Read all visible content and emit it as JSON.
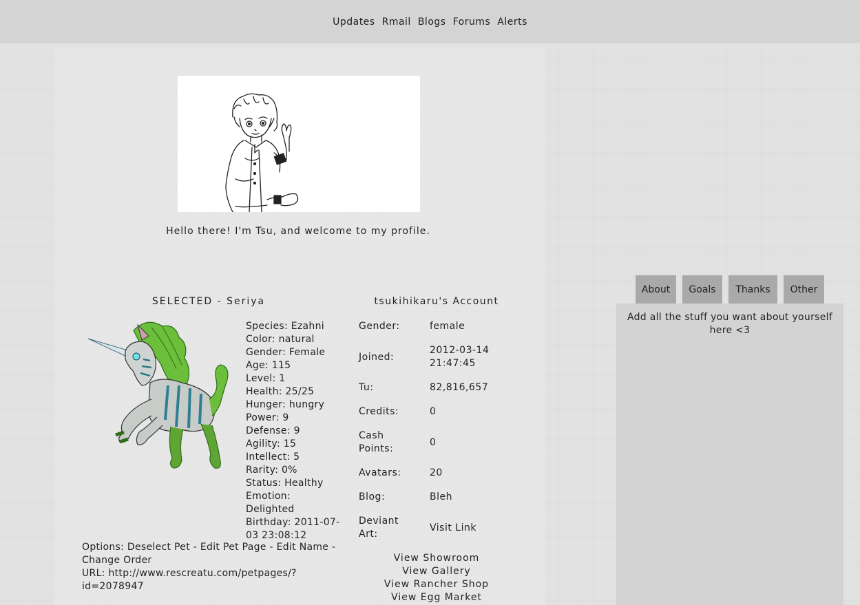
{
  "nav": {
    "items": [
      "Updates",
      "Rmail",
      "Blogs",
      "Forums",
      "Alerts"
    ]
  },
  "profile": {
    "welcome": "Hello there! I'm Tsu, and welcome to my profile."
  },
  "pet": {
    "title": "SELECTED - Seriya",
    "stats": [
      "Species: Ezahni",
      "Color: natural",
      "Gender: Female",
      "Age: 115",
      "Level: 1",
      "Health: 25/25",
      "Hunger: hungry",
      "Power: 9",
      "Defense: 9",
      "Agility: 15",
      "Intellect: 5",
      "Rarity: 0%",
      "Status: Healthy",
      "Emotion: Delighted",
      "Birthday: 2011-07-03 23:08:12"
    ],
    "options_label": "Options:",
    "options": [
      "Deselect Pet",
      "Edit Pet Page",
      "Edit Name",
      "Change Order"
    ],
    "separator": "-",
    "url_label": "URL:",
    "url": "http://www.rescreatu.com/petpages/?id=2078947"
  },
  "account": {
    "title": "tsukihikaru's Account",
    "rows": [
      {
        "label": "Gender:",
        "value": "female"
      },
      {
        "label": "Joined:",
        "value": "2012-03-14 21:47:45"
      },
      {
        "label": "Tu:",
        "value": "82,816,657"
      },
      {
        "label": "Credits:",
        "value": "0"
      },
      {
        "label": "Cash Points:",
        "value": "0"
      },
      {
        "label": "Avatars:",
        "value": "20"
      },
      {
        "label": "Blog:",
        "value": "Bleh"
      },
      {
        "label": "Deviant Art:",
        "value": "Visit Link"
      }
    ],
    "links": [
      "View Showroom",
      "View Gallery",
      "View Rancher Shop",
      "View Egg Market"
    ]
  },
  "sidebar": {
    "tabs": [
      "About",
      "Goals",
      "Thanks",
      "Other"
    ],
    "about_text": "Add all the stuff you want about yourself here <3"
  }
}
